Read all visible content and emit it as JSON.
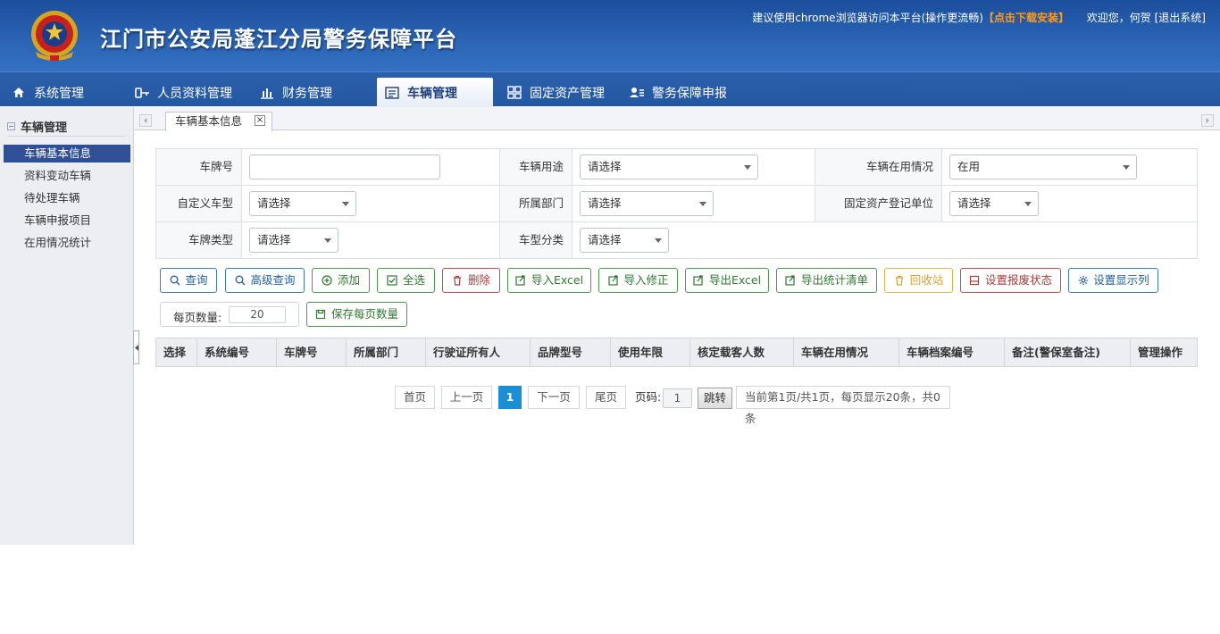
{
  "header": {
    "title": "江门市公安局蓬江分局警务保障平台",
    "notice_prefix": "建议使用chrome浏览器访问本平台(操作更流畅)",
    "download_link": "【点击下载安装】",
    "welcome": "欢迎您，何贺",
    "logout": "[退出系统]",
    "colors": {
      "header_bg": "#2a63b3",
      "download": "#ff9a1a"
    }
  },
  "nav": {
    "items": [
      {
        "label": "系统管理",
        "icon": "home-icon"
      },
      {
        "label": "人员资料管理",
        "icon": "key-icon"
      },
      {
        "label": "财务管理",
        "icon": "bar-chart-icon"
      },
      {
        "label": "车辆管理",
        "icon": "list-icon",
        "active": true
      },
      {
        "label": "固定资产管理",
        "icon": "grid-icon"
      },
      {
        "label": "警务保障申报",
        "icon": "user-card-icon"
      }
    ]
  },
  "sidebar": {
    "title": "车辆管理",
    "items": [
      {
        "label": "车辆基本信息",
        "active": true
      },
      {
        "label": "资料变动车辆"
      },
      {
        "label": "待处理车辆"
      },
      {
        "label": "车辆申报项目"
      },
      {
        "label": "在用情况统计"
      }
    ]
  },
  "tabs": {
    "active_label": "车辆基本信息",
    "close": "×"
  },
  "form": {
    "plate_no_label": "车牌号",
    "plate_no_value": "",
    "usage_label": "车辆用途",
    "usage_value": "请选择",
    "status_label": "车辆在用情况",
    "status_value": "在用",
    "custom_type_label": "自定义车型",
    "custom_type_value": "请选择",
    "dept_label": "所属部门",
    "dept_value": "请选择",
    "asset_unit_label": "固定资产登记单位",
    "asset_unit_value": "请选择",
    "plate_type_label": "车牌类型",
    "plate_type_value": "请选择",
    "model_class_label": "车型分类",
    "model_class_value": "请选择"
  },
  "toolbar": {
    "query": "查询",
    "advanced_query": "高级查询",
    "add": "添加",
    "select_all": "全选",
    "delete": "删除",
    "import_excel": "导入Excel",
    "import_fix": "导入修正",
    "export_excel": "导出Excel",
    "export_stats": "导出统计清单",
    "recycle": "回收站",
    "set_scrap": "设置报废状态",
    "set_columns": "设置显示列",
    "page_size_label": "每页数量:",
    "page_size_value": "20",
    "save_page_size": "保存每页数量"
  },
  "table": {
    "columns": [
      "选择",
      "系统编号",
      "车牌号",
      "所属部门",
      "行驶证所有人",
      "品牌型号",
      "使用年限",
      "核定载客人数",
      "车辆在用情况",
      "车辆档案编号",
      "备注(警保室备注)",
      "管理操作"
    ],
    "rows": []
  },
  "pagination": {
    "first": "首页",
    "prev": "上一页",
    "current": "1",
    "next": "下一页",
    "last": "尾页",
    "page_label": "页码:",
    "page_input": "1",
    "jump": "跳转",
    "info": "当前第1页/共1页，每页显示20条，共0条"
  }
}
